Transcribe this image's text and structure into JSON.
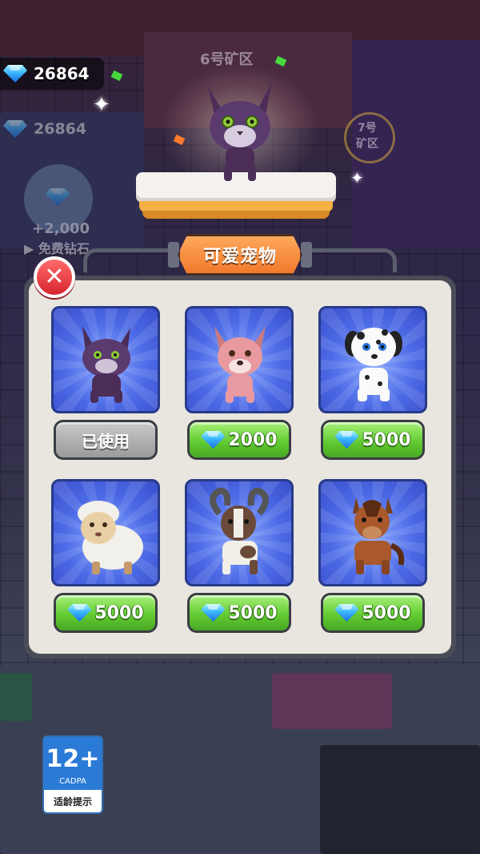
{
  "hud": {
    "gems": "26864",
    "gems_ghost": "26864",
    "free_gems_amount": "+2,000",
    "free_gems_label": "免费钻石"
  },
  "world": {
    "zone_6": "6号矿区",
    "zone_7_line1": "7号",
    "zone_7_line2": "矿区"
  },
  "shop": {
    "title": "可爱宠物",
    "pets": [
      {
        "name": "purple-cat",
        "status": "已使用"
      },
      {
        "name": "pink-dog",
        "price": "2000"
      },
      {
        "name": "dalmatian",
        "price": "5000"
      },
      {
        "name": "sheep",
        "price": "5000"
      },
      {
        "name": "goat",
        "price": "5000"
      },
      {
        "name": "horse",
        "price": "5000"
      }
    ]
  },
  "age_rating": {
    "age": "12+",
    "org": "CADPA",
    "tip": "适龄提示"
  },
  "colors": {
    "buy_button": "#63cc33",
    "used_button": "#9a9a9a",
    "card_bg": "#4c6ae6",
    "title_plate": "#f07a2b",
    "close_button": "#d8262f"
  }
}
